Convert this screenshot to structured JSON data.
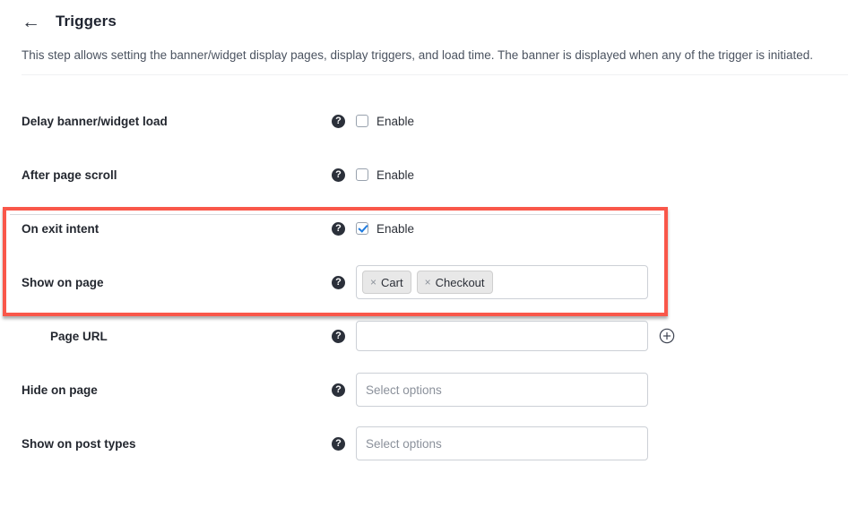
{
  "header": {
    "back_icon": "arrow-left-icon",
    "title": "Triggers",
    "description": "This step allows setting the banner/widget display pages, display triggers, and load time. The banner is displayed when any of the trigger is initiated."
  },
  "icons": {
    "help": "?",
    "plus": "+",
    "chip_remove": "×",
    "back_arrow": "←"
  },
  "colors": {
    "highlight": "#F9574A",
    "checkbox_checked": "#1F7CE0",
    "help_icon_bg": "#2B303A",
    "label_text": "#23272F",
    "placeholder_text": "#8B919B"
  },
  "rows": [
    {
      "label": "Delay banner/widget load",
      "control": "checkbox",
      "checkbox_label": "Enable",
      "checked": false,
      "indented": false,
      "highlighted": false
    },
    {
      "label": "After page scroll",
      "control": "checkbox",
      "checkbox_label": "Enable",
      "checked": false,
      "indented": false,
      "highlighted": false
    },
    {
      "label": "On exit intent",
      "control": "checkbox",
      "checkbox_label": "Enable",
      "checked": true,
      "indented": false,
      "highlighted": true
    },
    {
      "label": "Show on page",
      "control": "chips",
      "chips": [
        "Cart",
        "Checkout"
      ],
      "value": "",
      "placeholder": "",
      "indented": false,
      "highlighted": true
    },
    {
      "label": "Page URL",
      "control": "input-with-add",
      "value": "",
      "placeholder": "",
      "indented": true,
      "highlighted": false
    },
    {
      "label": "Hide on page",
      "control": "select",
      "value": "",
      "placeholder": "Select options",
      "indented": false,
      "highlighted": false
    },
    {
      "label": "Show on post types",
      "control": "select",
      "value": "",
      "placeholder": "Select options",
      "indented": false,
      "highlighted": false
    }
  ]
}
